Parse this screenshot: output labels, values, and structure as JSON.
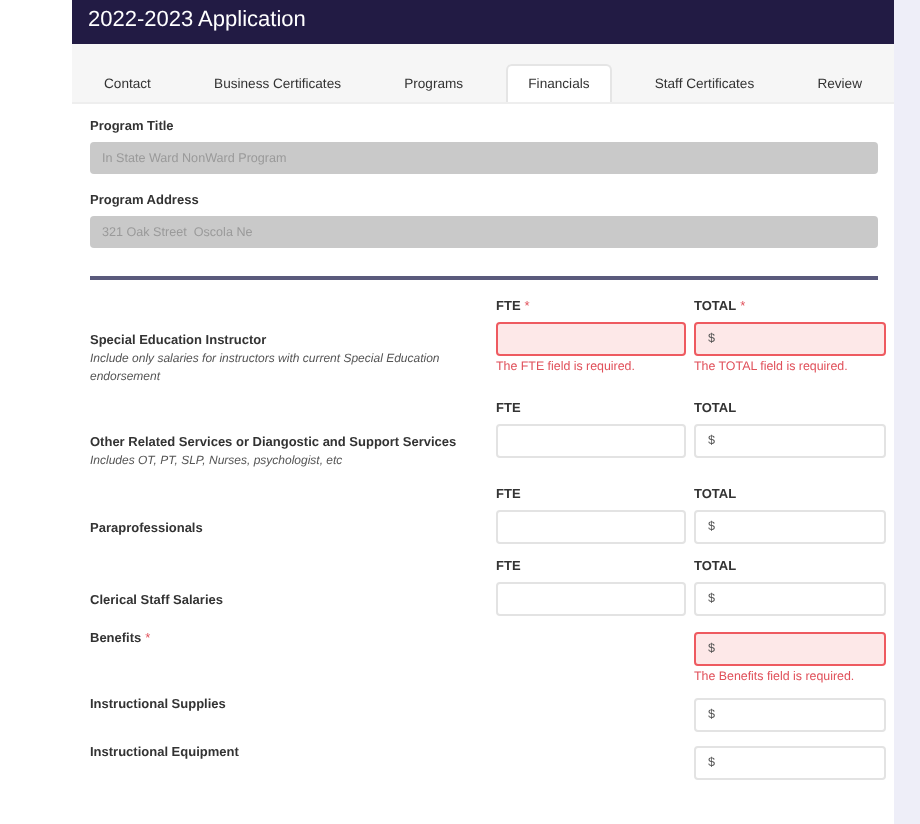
{
  "header": {
    "title": "2022-2023 Application"
  },
  "tabs": [
    {
      "label": "Contact",
      "selected": false
    },
    {
      "label": "Business Certificates",
      "selected": false
    },
    {
      "label": "Programs",
      "selected": false
    },
    {
      "label": "Financials",
      "selected": true
    },
    {
      "label": "Staff Certificates",
      "selected": false
    },
    {
      "label": "Review",
      "selected": false
    }
  ],
  "program_fields": [
    {
      "label": "Program Title",
      "value": "In State Ward NonWard Program",
      "disabled": true
    },
    {
      "label": "Program Address",
      "value": "321 Oak Street  Oscola Ne",
      "disabled": true
    }
  ],
  "expense_rows": [
    {
      "kind": "pair",
      "label": "Special Education Instructor",
      "hint": "Include only salaries for instructors with current Special Education endorsement",
      "fte": {
        "heading": "FTE",
        "required_mark": "*",
        "invalid": true,
        "error": "The FTE field is required."
      },
      "total": {
        "heading": "TOTAL",
        "required_mark": "*",
        "invalid": true,
        "placeholder": "$",
        "error": "The TOTAL field is required."
      }
    },
    {
      "kind": "pair",
      "label": "Other Related Services or Diangostic and Support Services",
      "hint": "Includes OT, PT, SLP, Nurses, psychologist, etc",
      "fte": {
        "heading": "FTE",
        "invalid": false
      },
      "total": {
        "heading": "TOTAL",
        "invalid": false,
        "placeholder": "$"
      }
    },
    {
      "kind": "pair",
      "label": "Paraprofessionals",
      "fte": {
        "heading": "FTE",
        "invalid": false
      },
      "total": {
        "heading": "TOTAL",
        "invalid": false,
        "placeholder": "$"
      }
    },
    {
      "kind": "pair",
      "label": "Clerical Staff Salaries",
      "fte": {
        "heading": "FTE",
        "invalid": false
      },
      "total": {
        "heading": "TOTAL",
        "invalid": false,
        "placeholder": "$"
      }
    },
    {
      "kind": "single",
      "label": "Benefits",
      "required_mark": "*",
      "total": {
        "invalid": true,
        "placeholder": "$",
        "error": "The Benefits field is required."
      }
    },
    {
      "kind": "single",
      "label": "Instructional Supplies",
      "total": {
        "invalid": false,
        "placeholder": "$"
      }
    },
    {
      "kind": "single",
      "label": "Instructional Equipment",
      "total": {
        "invalid": false,
        "placeholder": "$"
      }
    }
  ]
}
